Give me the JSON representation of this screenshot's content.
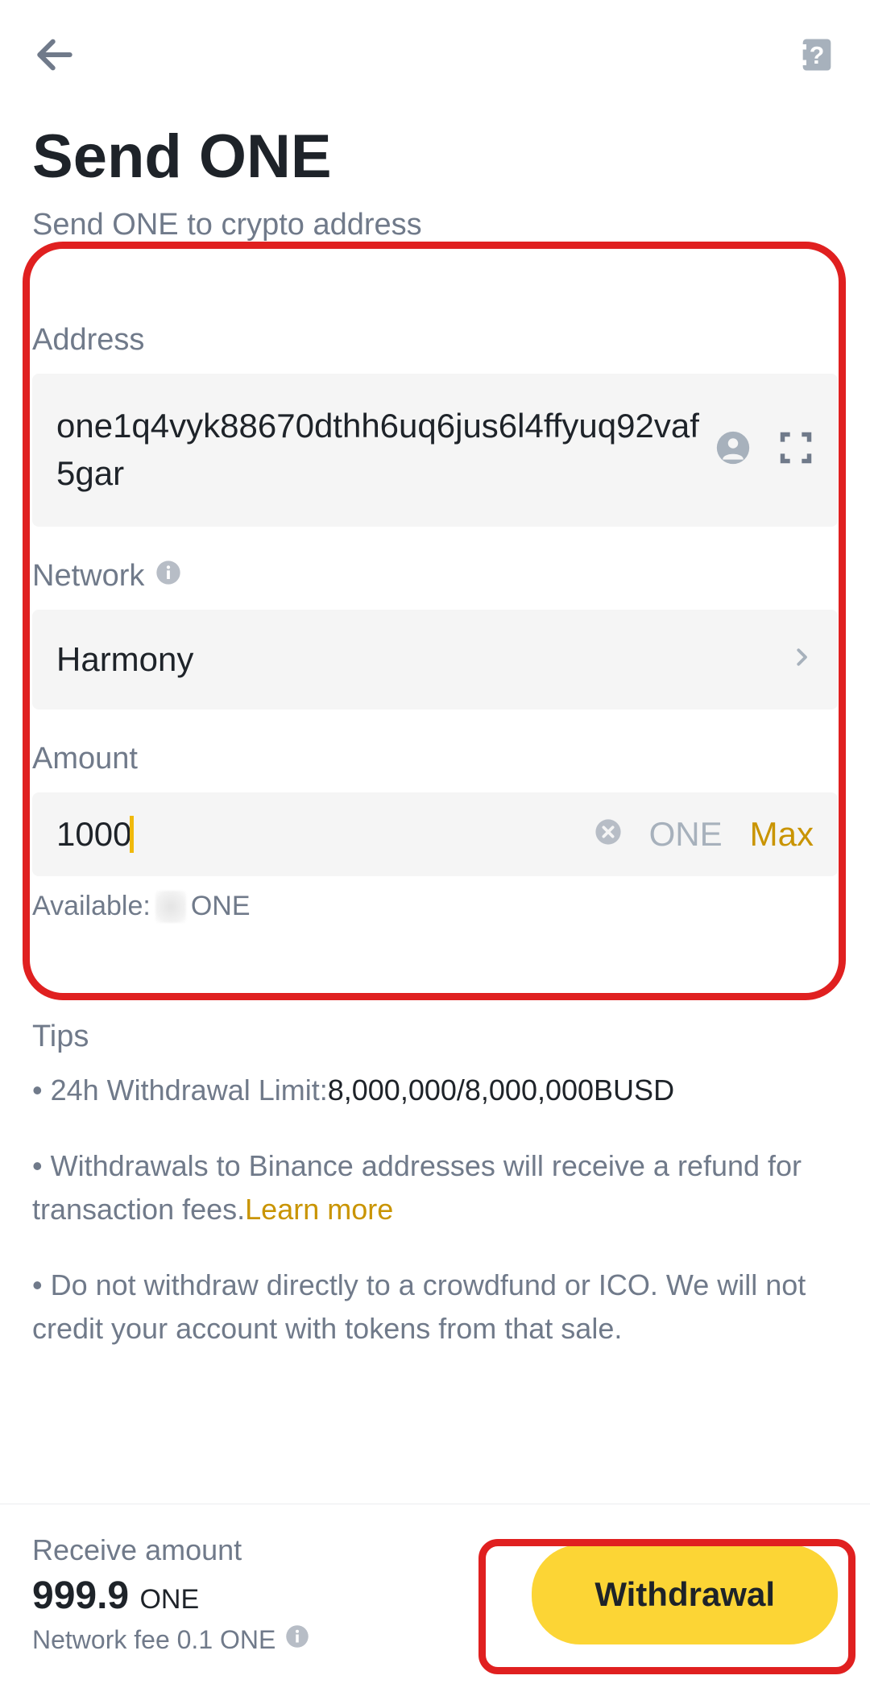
{
  "header": {
    "title": "Send ONE",
    "subtitle": "Send ONE to crypto address"
  },
  "address": {
    "label": "Address",
    "value": "one1q4vyk88670dthh6uq6jus6l4ffyuq92vaf5gar"
  },
  "network": {
    "label": "Network",
    "value": "Harmony"
  },
  "amount": {
    "label": "Amount",
    "value": "1000",
    "currency": "ONE",
    "max_label": "Max",
    "available_prefix": "Available:",
    "available_unit": "ONE"
  },
  "tips": {
    "title": "Tips",
    "line1_prefix": "• 24h Withdrawal Limit:",
    "line1_value": "8,000,000/8,000,000BUSD",
    "line2_text": "• Withdrawals to Binance addresses will receive a refund for transaction fees.",
    "learn_more": "Learn more",
    "line3_text": "• Do not withdraw directly to a crowdfund or ICO. We will not credit your account with tokens from that sale."
  },
  "footer": {
    "receive_label": "Receive amount",
    "receive_value": "999.9",
    "receive_unit": "ONE",
    "fee_label": "Network fee 0.1 ONE",
    "button": "Withdrawal"
  }
}
